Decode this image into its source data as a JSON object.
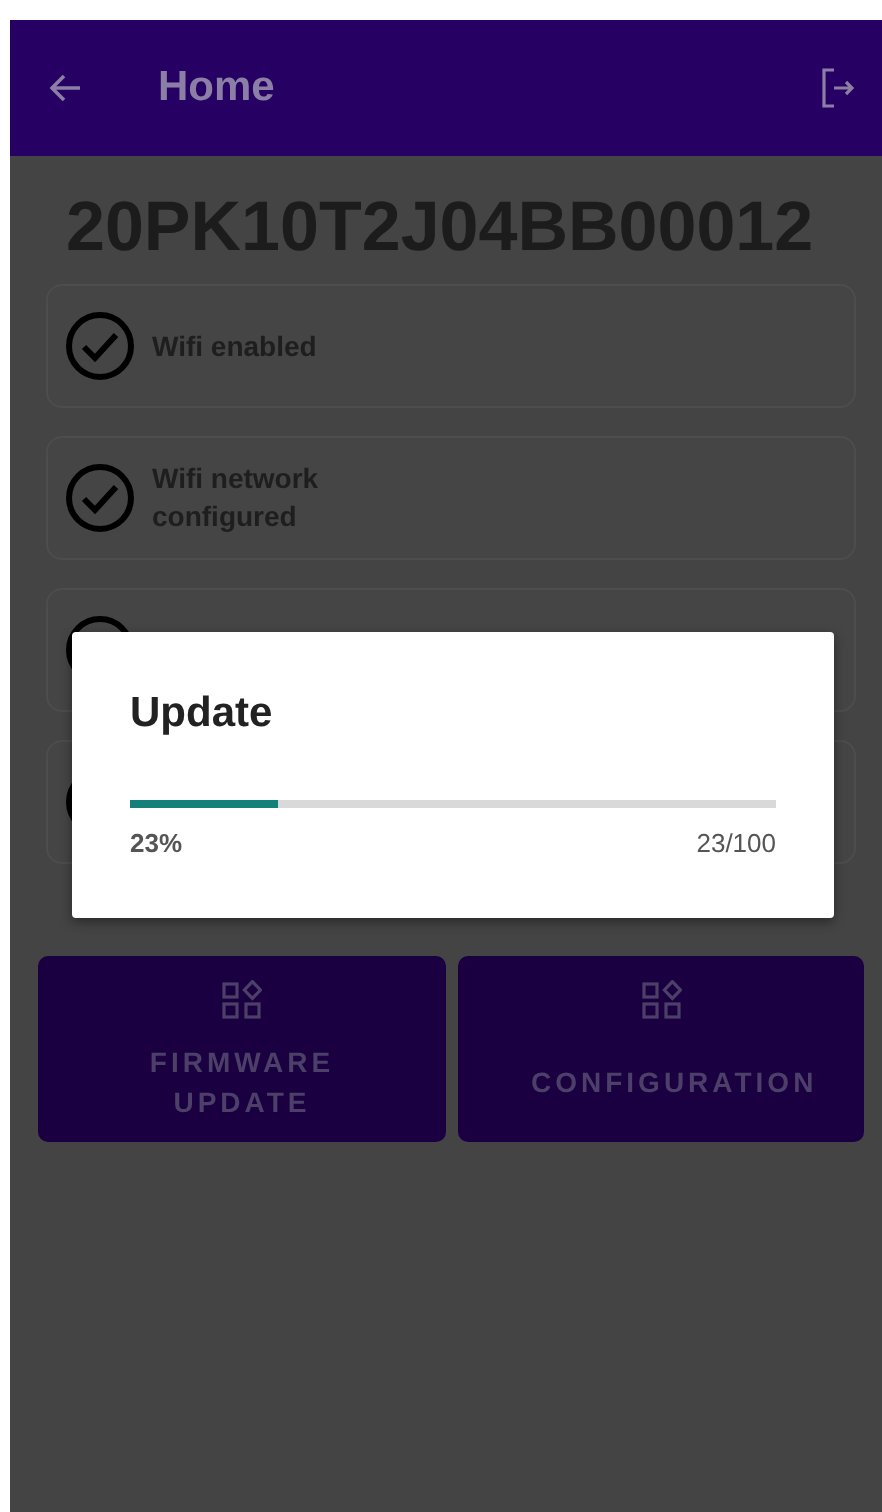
{
  "app_bar": {
    "title": "Home"
  },
  "serial": "20PK10T2J04BB00012",
  "status_items": [
    {
      "kind": "status",
      "label": "Wifi enabled",
      "checked": true
    },
    {
      "kind": "status",
      "label": "Wifi network configured",
      "checked": true
    },
    {
      "kind": "covered"
    },
    {
      "kind": "covered"
    }
  ],
  "actions": [
    {
      "label": "FIRMWARE UPDATE"
    },
    {
      "label": "CONFIGURATION"
    }
  ],
  "dialog": {
    "title": "Update",
    "level": 0.23,
    "percent": "23%",
    "count": "23/100"
  }
}
